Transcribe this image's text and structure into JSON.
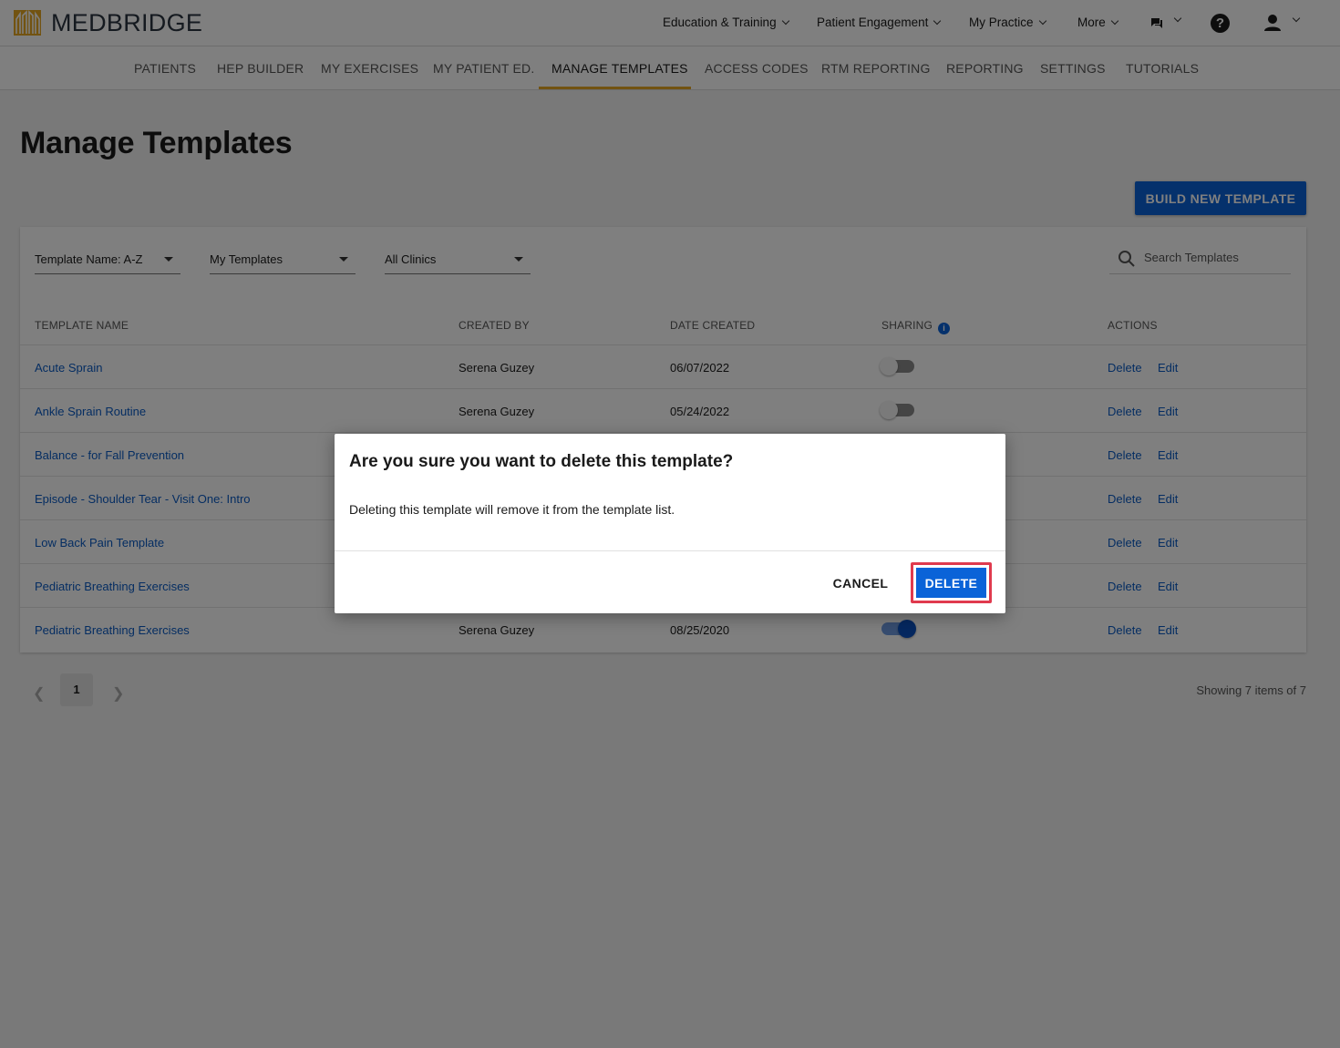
{
  "brand": {
    "name": "MEDBRIDGE",
    "logo_color": "#e5a623"
  },
  "topnav": {
    "items": [
      {
        "label": "Education & Training"
      },
      {
        "label": "Patient Engagement"
      },
      {
        "label": "My Practice"
      },
      {
        "label": "More"
      }
    ],
    "icons": [
      "chat-icon",
      "help-icon",
      "user-icon"
    ]
  },
  "subnav": {
    "items": [
      {
        "label": "PATIENTS"
      },
      {
        "label": "HEP BUILDER"
      },
      {
        "label": "MY EXERCISES"
      },
      {
        "label": "MY PATIENT ED."
      },
      {
        "label": "MANAGE TEMPLATES",
        "active": true
      },
      {
        "label": "ACCESS CODES"
      },
      {
        "label": "RTM REPORTING"
      },
      {
        "label": "REPORTING"
      },
      {
        "label": "SETTINGS"
      },
      {
        "label": "TUTORIALS"
      }
    ]
  },
  "page": {
    "title": "Manage Templates",
    "build_button": "BUILD NEW TEMPLATE"
  },
  "filters": {
    "sort": "Template Name: A-Z",
    "owner": "My Templates",
    "clinic": "All Clinics",
    "search_placeholder": "Search Templates"
  },
  "table": {
    "headers": [
      "TEMPLATE NAME",
      "CREATED BY",
      "DATE CREATED",
      "SHARING",
      "ACTIONS"
    ],
    "rows": [
      {
        "name": "Acute Sprain",
        "created_by": "Serena Guzey",
        "date": "06/07/2022",
        "sharing": false,
        "delete": "Delete",
        "edit": "Edit"
      },
      {
        "name": "Ankle Sprain Routine",
        "created_by": "Serena Guzey",
        "date": "05/24/2022",
        "sharing": false,
        "delete": "Delete",
        "edit": "Edit"
      },
      {
        "name": "Balance - for Fall Prevention",
        "created_by": "",
        "date": "",
        "sharing": null,
        "delete": "Delete",
        "edit": "Edit"
      },
      {
        "name": "Episode - Shoulder Tear - Visit One: Intro",
        "created_by": "",
        "date": "",
        "sharing": null,
        "delete": "Delete",
        "edit": "Edit"
      },
      {
        "name": "Low Back Pain Template",
        "created_by": "",
        "date": "",
        "sharing": null,
        "delete": "Delete",
        "edit": "Edit"
      },
      {
        "name": "Pediatric Breathing Exercises",
        "created_by": "",
        "date": "",
        "sharing": null,
        "delete": "Delete",
        "edit": "Edit"
      },
      {
        "name": "Pediatric Breathing Exercises",
        "created_by": "Serena Guzey",
        "date": "08/25/2020",
        "sharing": true,
        "delete": "Delete",
        "edit": "Edit"
      }
    ]
  },
  "pagination": {
    "current_page": "1",
    "summary": "Showing 7 items of 7"
  },
  "dialog": {
    "title": "Are you sure you want to delete this template?",
    "body": "Deleting this template will remove it from the template list.",
    "cancel_label": "CANCEL",
    "delete_label": "DELETE",
    "highlight_color": "#e03a4e"
  },
  "colors": {
    "primary": "#0a63d8",
    "link": "#0a5bc4",
    "accent": "#e5a623"
  }
}
